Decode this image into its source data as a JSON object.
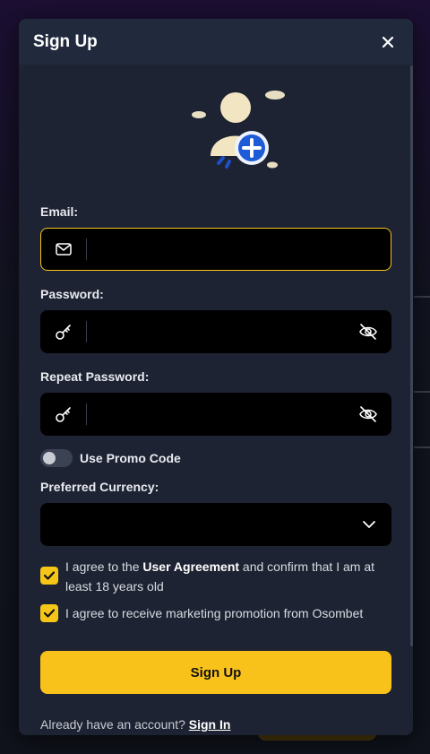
{
  "modal": {
    "title": "Sign Up"
  },
  "email": {
    "label": "Email:",
    "value": "",
    "placeholder": ""
  },
  "password": {
    "label": "Password:",
    "value": "",
    "placeholder": ""
  },
  "repeat_password": {
    "label": "Repeat Password:",
    "value": "",
    "placeholder": ""
  },
  "promo": {
    "label": "Use Promo Code",
    "enabled": false
  },
  "currency": {
    "label": "Preferred Currency:",
    "selected": ""
  },
  "agreement": {
    "prefix": "I agree to the ",
    "link": "User Agreement",
    "suffix": " and confirm that I am at least 18 years old",
    "checked": true
  },
  "marketing": {
    "label": "I agree to receive marketing promotion from Osombet",
    "checked": true
  },
  "submit": {
    "label": "Sign Up"
  },
  "footer": {
    "text": "Already have an account? ",
    "link": "Sign In"
  },
  "colors": {
    "accent": "#f9c21a",
    "panel": "#1d2332",
    "header": "#212a3d",
    "input_bg": "#000000"
  },
  "icons": [
    "close-icon",
    "user-add-illustration",
    "envelope-icon",
    "key-icon",
    "eye-off-icon",
    "chevron-down-icon",
    "checkmark-icon"
  ]
}
